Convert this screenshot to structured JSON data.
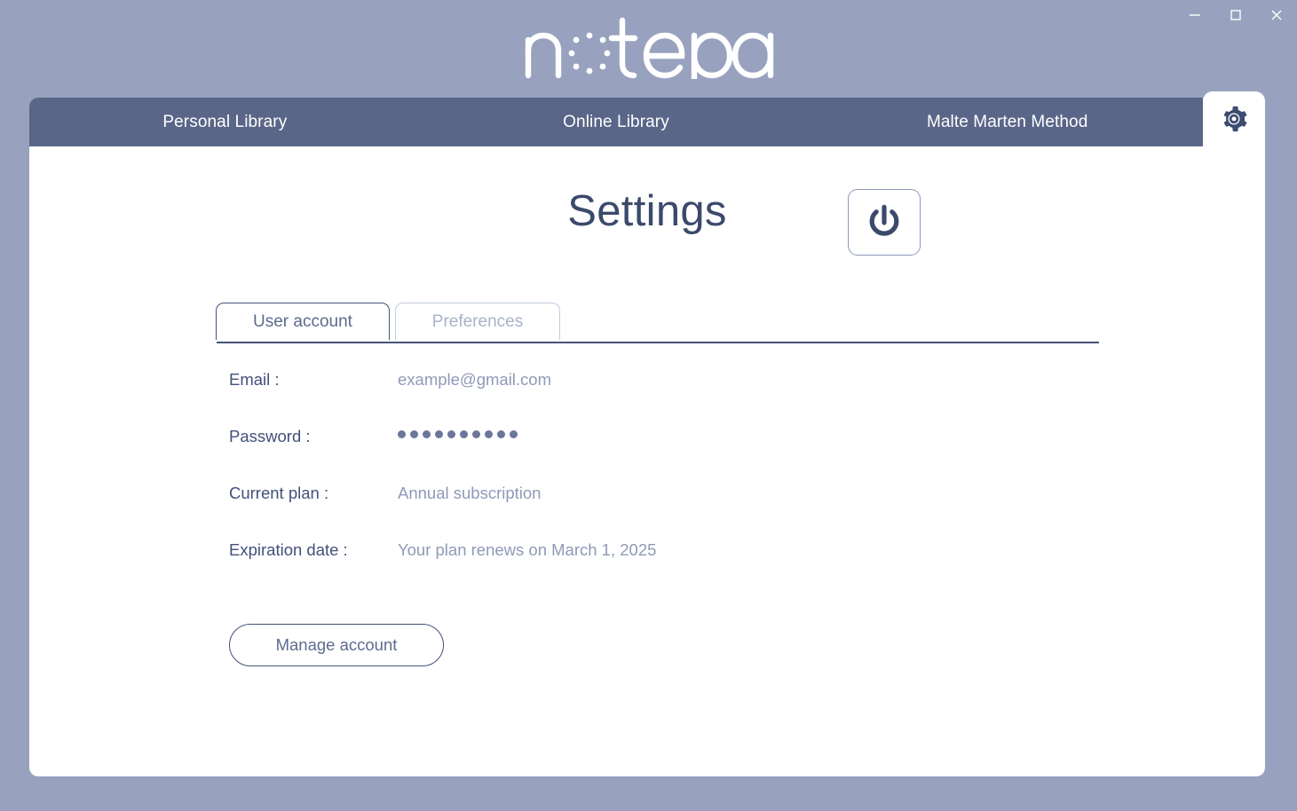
{
  "window": {
    "minimize_label": "Minimize",
    "maximize_label": "Maximize",
    "close_label": "Close"
  },
  "brand": {
    "name": "notepan",
    "logo_text_before": "n",
    "logo_text_after": "tepan",
    "logo_color": "#ffffff"
  },
  "colors": {
    "background": "#98a2bf",
    "navbar": "#5a6688",
    "card": "#ffffff",
    "accent_dark": "#3b4a6b",
    "text_muted": "#8f9ab8",
    "tab_inactive": "#a9b2c9"
  },
  "navbar": {
    "items": [
      {
        "label": "Personal Library"
      },
      {
        "label": "Online Library"
      },
      {
        "label": "Malte Marten Method"
      }
    ],
    "settings_icon": "gear-icon"
  },
  "main": {
    "title": "Settings",
    "power_icon": "power-icon",
    "tabs": [
      {
        "label": "User account",
        "active": true
      },
      {
        "label": "Preferences",
        "active": false
      }
    ],
    "fields": [
      {
        "label": "Email :",
        "value": "example@gmail.com",
        "type": "text"
      },
      {
        "label": "Password :",
        "value": "••••••••••",
        "type": "password",
        "dot_count": 10
      },
      {
        "label": "Current plan :",
        "value": "Annual subscription",
        "type": "text"
      },
      {
        "label": "Expiration date :",
        "value": "Your plan renews on March 1, 2025",
        "type": "text"
      }
    ],
    "manage_button": "Manage account"
  }
}
